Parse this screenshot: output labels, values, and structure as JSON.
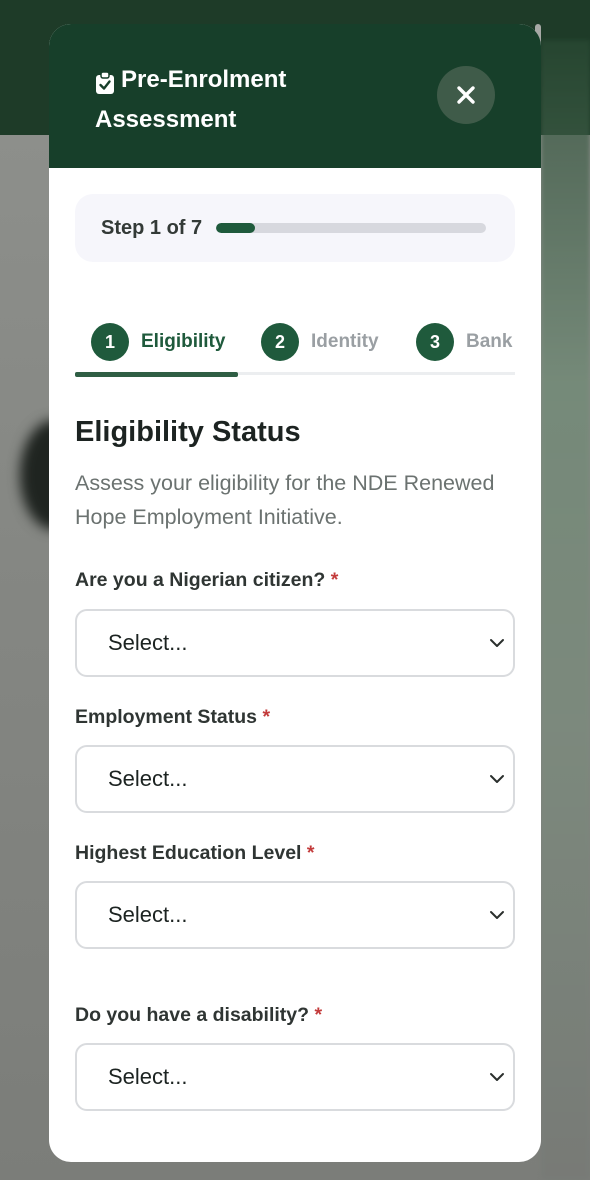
{
  "modal": {
    "title_line1": "Pre-Enrolment",
    "title_line2": "Assessment",
    "close_label": "×"
  },
  "progress": {
    "step_text": "Step 1 of 7",
    "fraction": 0.143
  },
  "tabs": [
    {
      "number": "1",
      "label": "Eligibility",
      "active": true
    },
    {
      "number": "2",
      "label": "Identity",
      "active": false
    },
    {
      "number": "3",
      "label": "Bank",
      "active": false
    }
  ],
  "section": {
    "title": "Eligibility Status",
    "description": "Assess your eligibility for the NDE Renewed Hope Employment Initiative."
  },
  "fields": [
    {
      "label": "Are you a Nigerian citizen?",
      "required_mark": "*",
      "value": "Select..."
    },
    {
      "label": "Employment Status",
      "required_mark": "*",
      "value": "Select..."
    },
    {
      "label": "Highest Education Level",
      "required_mark": "*",
      "value": "Select..."
    },
    {
      "label": "Do you have a disability?",
      "required_mark": "*",
      "value": "Select..."
    }
  ],
  "colors": {
    "header_bg": "#173f2a",
    "accent": "#1f5a3c",
    "required": "#c33b3b"
  }
}
